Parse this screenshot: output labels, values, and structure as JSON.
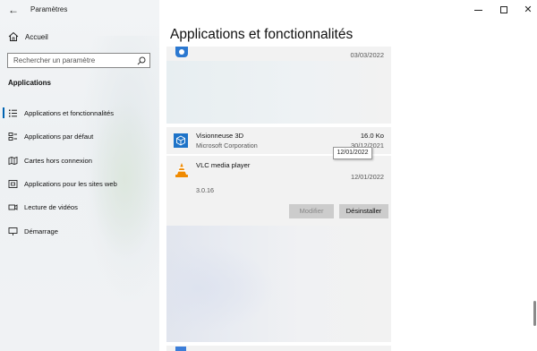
{
  "window": {
    "title": "Paramètres",
    "back_glyph": "←",
    "close_glyph": "✕"
  },
  "sidebar": {
    "home_label": "Accueil",
    "search_placeholder": "Rechercher un paramètre",
    "section_title": "Applications",
    "items": [
      {
        "label": "Applications et fonctionnalités",
        "icon": "list-icon",
        "selected": true
      },
      {
        "label": "Applications par défaut",
        "icon": "default-apps-icon",
        "selected": false
      },
      {
        "label": "Cartes hors connexion",
        "icon": "map-icon",
        "selected": false
      },
      {
        "label": "Applications pour les sites web",
        "icon": "web-apps-icon",
        "selected": false
      },
      {
        "label": "Lecture de vidéos",
        "icon": "video-icon",
        "selected": false
      },
      {
        "label": "Démarrage",
        "icon": "startup-icon",
        "selected": false
      }
    ]
  },
  "main": {
    "page_title": "Applications et fonctionnalités",
    "top_app": {
      "date": "03/03/2022"
    },
    "apps": [
      {
        "name": "Visionneuse 3D",
        "publisher": "Microsoft Corporation",
        "size": "16.0 Ko",
        "date": "30/12/2021",
        "icon": "cube-3d-icon"
      },
      {
        "name": "VLC media player",
        "version": "3.0.16",
        "date": "12/01/2022",
        "icon": "vlc-cone-icon"
      }
    ],
    "tooltip": "12/01/2022",
    "buttons": {
      "modify": "Modifier",
      "uninstall": "Désinstaller"
    }
  },
  "colors": {
    "accent": "#0063b1",
    "card_bg": "#f2f2f2",
    "sidebar_bg": "#eff2f4",
    "vlc_orange": "#f08a00"
  }
}
